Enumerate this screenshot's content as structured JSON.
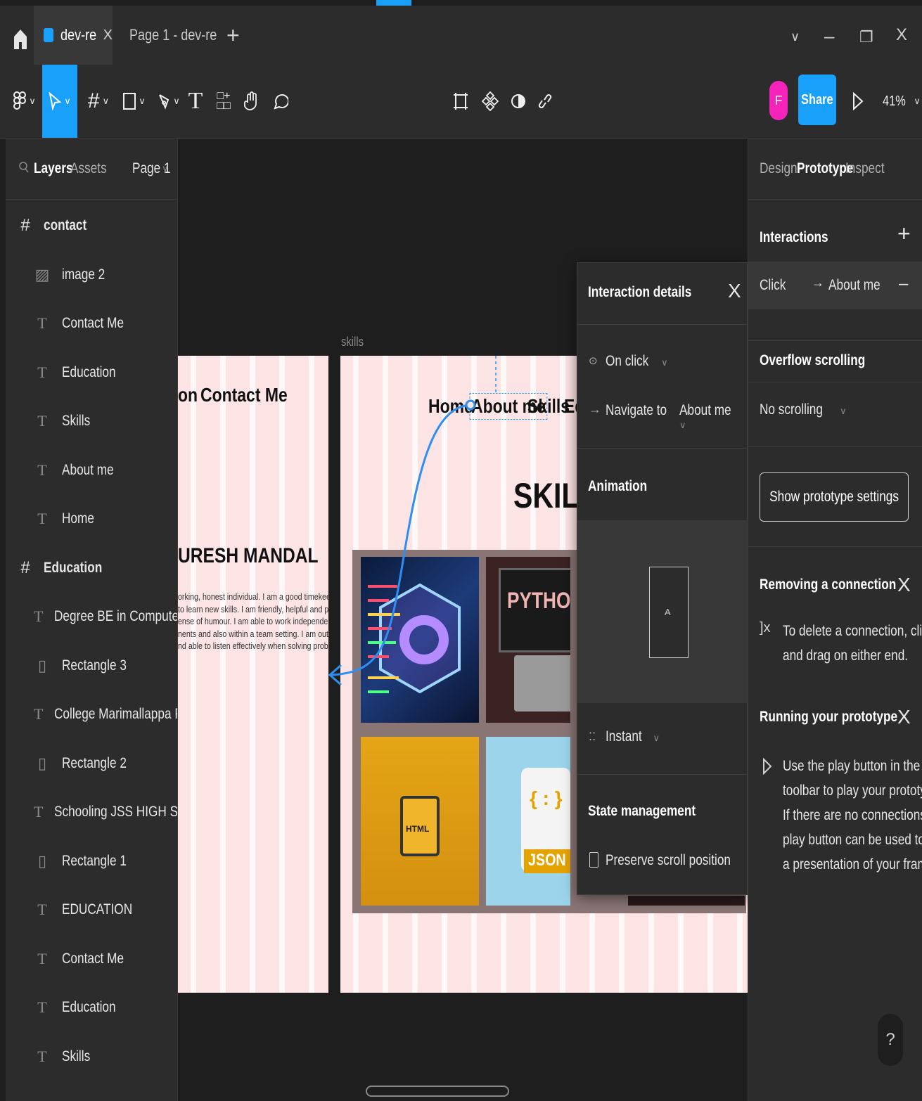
{
  "window": {
    "tabs": [
      {
        "label": "dev-re",
        "close": "X"
      },
      {
        "label": "Page 1 - dev-re"
      }
    ],
    "add_tab": "+",
    "controls": {
      "dropdown": "∨",
      "minimize": "–",
      "restore": "❐",
      "close": "X"
    }
  },
  "toolbar": {
    "share_label": "Share",
    "avatar_initial": "F",
    "zoom": "41%"
  },
  "left_panel": {
    "tabs": {
      "layers": "Layers",
      "assets": "Assets"
    },
    "page_selector": "Page 1",
    "layers": [
      {
        "label": "contact",
        "type": "frame"
      },
      {
        "label": "image 2",
        "type": "image"
      },
      {
        "label": "Contact Me",
        "type": "text"
      },
      {
        "label": "Education",
        "type": "text"
      },
      {
        "label": "Skills",
        "type": "text"
      },
      {
        "label": "About me",
        "type": "text"
      },
      {
        "label": "Home",
        "type": "text"
      },
      {
        "label": "Education",
        "type": "frame"
      },
      {
        "label": "Degree BE in Computer Scien...",
        "type": "text"
      },
      {
        "label": "Rectangle 3",
        "type": "rect"
      },
      {
        "label": "College Marimallappa PU Coll...",
        "type": "text"
      },
      {
        "label": "Rectangle 2",
        "type": "rect"
      },
      {
        "label": "Schooling JSS HIGH SCHOOL...",
        "type": "text"
      },
      {
        "label": "Rectangle 1",
        "type": "rect"
      },
      {
        "label": "EDUCATION",
        "type": "text"
      },
      {
        "label": "Contact Me",
        "type": "text"
      },
      {
        "label": "Education",
        "type": "text"
      },
      {
        "label": "Skills",
        "type": "text"
      }
    ]
  },
  "canvas": {
    "frame1": {
      "nav_partial": "on",
      "nav_contact": "Contact Me",
      "name_partial": "URESH MANDAL",
      "bio_lines": [
        "orking, honest individual. I am a good timekeeper,",
        "to learn new skills. I am friendly, helpful and polite,",
        "ense of humour. I am able to work independently in",
        "nents and also within a team setting. I am outgoing a",
        "nd able to listen effectively when solving problems"
      ]
    },
    "frame2": {
      "label": "skills",
      "nav": {
        "home": "Home",
        "about": "About me",
        "skills": "Skills",
        "edu_partial": "Ed"
      },
      "heading": "SKILLS",
      "tile_python": "PYTHON",
      "tile_html": "HTML",
      "tile_json": "JSON",
      "tile_json_braces": "{ : }"
    }
  },
  "interaction_popup": {
    "title": "Interaction details",
    "trigger": "On click",
    "action": "Navigate to",
    "destination": "About me",
    "animation_title": "Animation",
    "preview_letter": "A",
    "transition": "Instant",
    "state_title": "State management",
    "preserve_scroll": "Preserve scroll position"
  },
  "right_panel": {
    "tabs": {
      "design": "Design",
      "prototype": "Prototype",
      "inspect": "Inspect"
    },
    "interactions_title": "Interactions",
    "interaction_trigger": "Click",
    "interaction_target": "About me",
    "overflow_title": "Overflow scrolling",
    "overflow_value": "No scrolling",
    "prototype_settings_btn": "Show prototype settings",
    "removing_title": "Removing a connection",
    "removing_text": [
      "To delete a connection, click",
      "and drag on either end."
    ],
    "running_title": "Running your prototype",
    "running_text": [
      "Use the play button in the",
      "toolbar to play your prototype.",
      "If there are no connections, the",
      "play button can be used to play",
      "a presentation of your frames."
    ],
    "help": "?"
  },
  "colors": {
    "accent": "#18a0fb",
    "avatar": "#f523b9",
    "panel": "#2c2c2c",
    "canvas": "#1e1e1e",
    "frame_bg": "#fde4e4"
  }
}
